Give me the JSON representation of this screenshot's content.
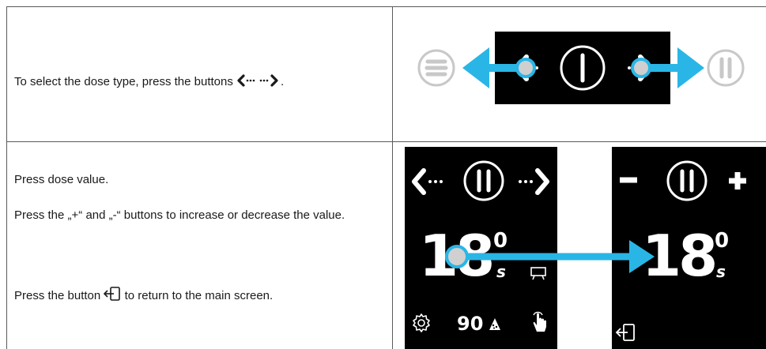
{
  "row1": {
    "text": "To select the dose type, press the buttons",
    "period": "."
  },
  "row2": {
    "line1": "Press dose value.",
    "line2": "Press the „+“ and „-“ buttons to increase or decrease the value.",
    "line3a": "Press the button",
    "line3b": "to return to the main screen."
  },
  "screen_left": {
    "dose_main": "18",
    "dose_decimal": "0",
    "unit": "s",
    "secondary_value": "90"
  },
  "screen_right": {
    "dose_main": "18",
    "dose_decimal": "0",
    "unit": "s"
  },
  "colors": {
    "accent": "#29b6e6",
    "panel": "#000000",
    "button_gray": "#c8c8c8"
  },
  "icons": [
    "left-dots-arrow-icon",
    "right-dots-arrow-icon",
    "menu-icon",
    "single-shot-icon",
    "double-shot-icon",
    "minus-icon",
    "plus-icon",
    "cup-icon",
    "gear-icon",
    "grind-icon",
    "touch-icon",
    "exit-icon"
  ]
}
